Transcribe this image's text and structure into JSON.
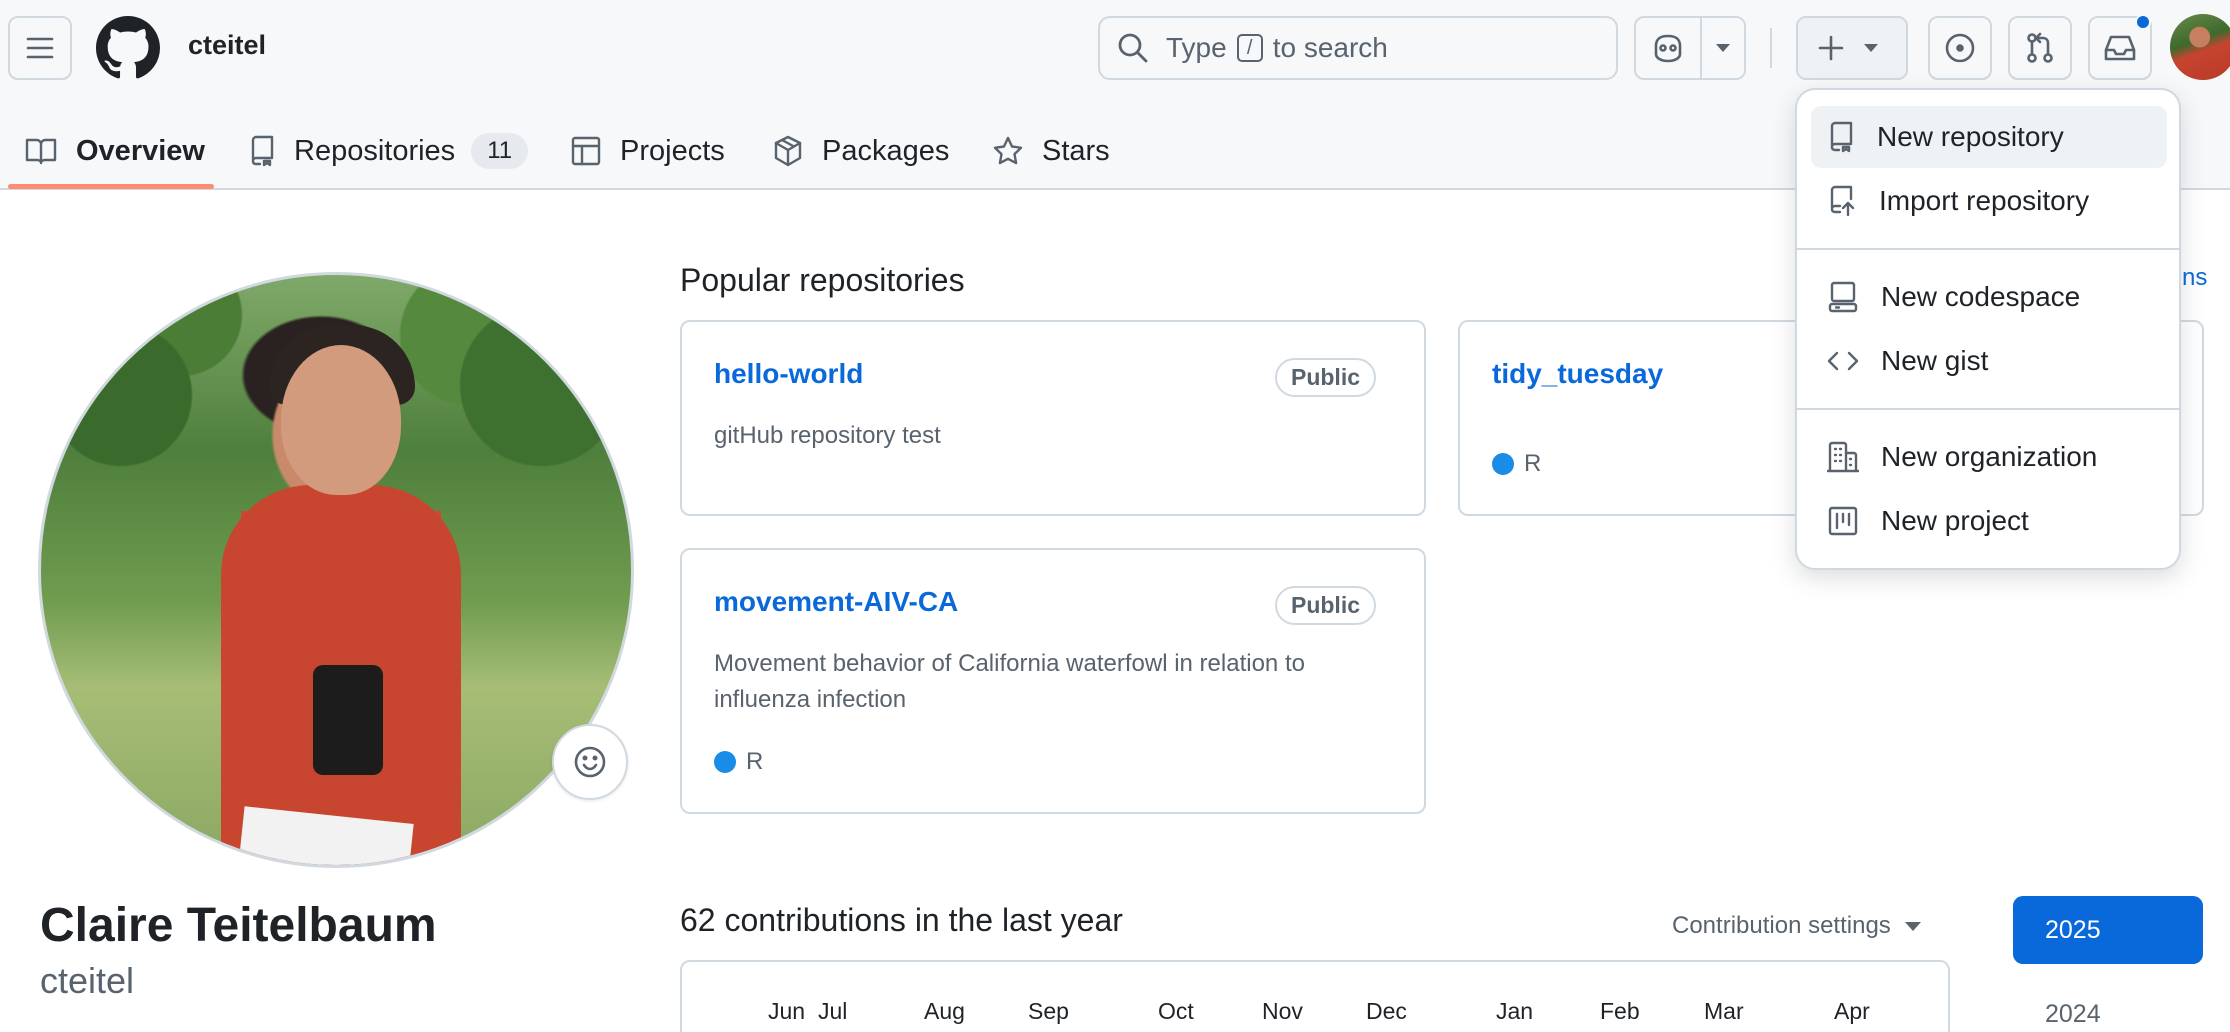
{
  "header": {
    "username": "cteitel",
    "search_prefix": "Type",
    "search_key": "/",
    "search_suffix": "to search"
  },
  "tabs": [
    {
      "label": "Overview"
    },
    {
      "label": "Repositories",
      "count": "11"
    },
    {
      "label": "Projects"
    },
    {
      "label": "Packages"
    },
    {
      "label": "Stars"
    }
  ],
  "profile": {
    "full_name": "Claire Teitelbaum",
    "login": "cteitel"
  },
  "popular": {
    "title": "Popular repositories",
    "customize_partial": "ns",
    "repos": [
      {
        "name": "hello-world",
        "visibility": "Public",
        "description": "gitHub repository test",
        "language": ""
      },
      {
        "name": "tidy_tuesday",
        "visibility": "",
        "description": "",
        "language": "R"
      },
      {
        "name": "movement-AIV-CA",
        "visibility": "Public",
        "description": "Movement behavior of California waterfowl in relation to influenza infection",
        "language": "R"
      }
    ]
  },
  "contributions": {
    "title": "62 contributions in the last year",
    "settings_label": "Contribution settings",
    "months": [
      "Jun",
      "Jul",
      "Aug",
      "Sep",
      "Oct",
      "Nov",
      "Dec",
      "Jan",
      "Feb",
      "Mar",
      "Apr"
    ],
    "years": [
      "2025",
      "2024"
    ]
  },
  "create_menu": {
    "items": [
      {
        "label": "New repository"
      },
      {
        "label": "Import repository"
      },
      {
        "label": "New codespace"
      },
      {
        "label": "New gist"
      },
      {
        "label": "New organization"
      },
      {
        "label": "New project"
      }
    ]
  },
  "colors": {
    "link": "#0969da",
    "tab_underline": "#fd8c73",
    "language_r": "#198ce7"
  }
}
